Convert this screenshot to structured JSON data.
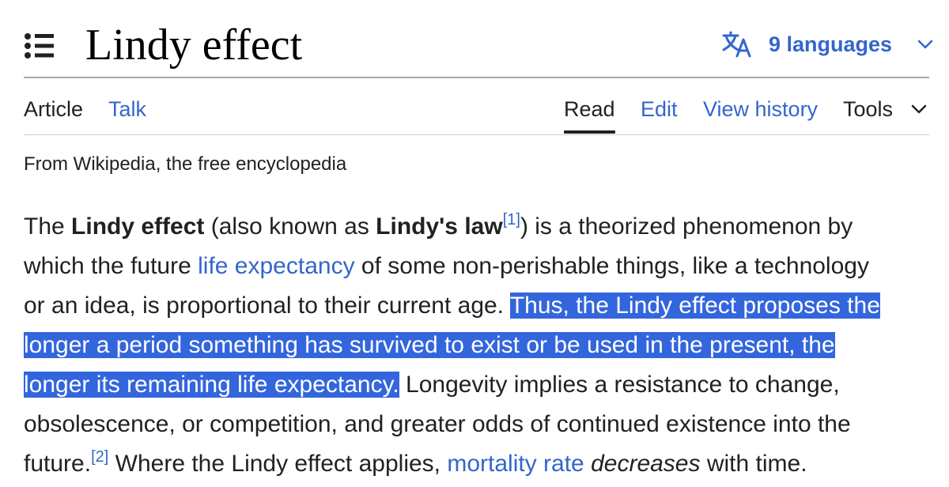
{
  "page": {
    "title": "Lindy effect",
    "languages_label": "9 languages",
    "tagline": "From Wikipedia, the free encyclopedia"
  },
  "tabs": {
    "article": "Article",
    "talk": "Talk",
    "read": "Read",
    "edit": "Edit",
    "history": "View history",
    "tools": "Tools"
  },
  "icons": {
    "toc": "toc-list-icon",
    "language": "translate-icon",
    "dropdown": "chevron-down-icon"
  },
  "colors": {
    "link": "#3366cc",
    "text": "#202122",
    "selection": "#3366dd"
  },
  "body": {
    "t1": "The ",
    "b1": "Lindy effect",
    "t2": " (also known as ",
    "b2": "Lindy's law",
    "ref1": "[1]",
    "t3": ") is a theorized phenomenon by",
    "t4": "which the future ",
    "link1": "life expectancy",
    "t5": " of some non-perishable things, like a technology",
    "t6": "or an idea, is proportional to their current age. ",
    "sel1": "Thus, the Lindy effect proposes the",
    "sel2": "longer a period something has survived to exist or be used in the present, the",
    "sel3": "longer its remaining life expectancy.",
    "t7": " Longevity implies a resistance to change,",
    "t8": "obsolescence, or competition, and greater odds of continued existence into the",
    "t9": "future.",
    "ref2": "[2]",
    "t10": " Where the Lindy effect applies, ",
    "link2": "mortality rate",
    "t11": " ",
    "em1": "decreases",
    "t12": " with time."
  }
}
